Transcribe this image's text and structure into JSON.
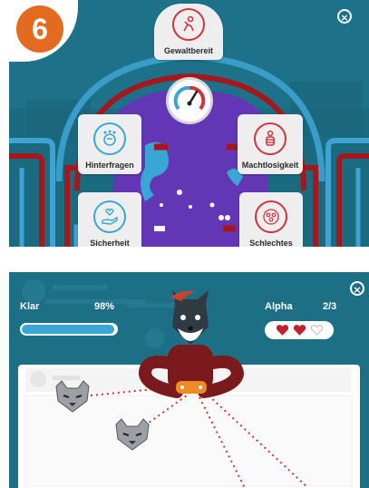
{
  "top_panel": {
    "step_number": "6",
    "close_icon": "close-icon",
    "nodes": {
      "gewaltbereit": {
        "label": "Gewaltbereit",
        "icon": "figure-icon"
      },
      "hinterfragen": {
        "label": "Hinterfragen",
        "icon": "thinking-head-icon"
      },
      "machtlosigkeit": {
        "label": "Machtlosigkeit",
        "icon": "bound-person-icon"
      },
      "sicherheit": {
        "label": "Sicherheit",
        "icon": "hand-heart-icon"
      },
      "schlechtes": {
        "label": "Schlechtes",
        "icon": "group-icon"
      }
    },
    "gauge_icon": "gauge-icon",
    "colors": {
      "accent_red": "#d0343d",
      "accent_blue": "#3aa6d6",
      "pipe_red": "#a5171d",
      "pipe_blue": "#3fa3d3",
      "purple": "#6236b4"
    }
  },
  "bottom_panel": {
    "close_icon": "close-icon",
    "klar": {
      "label": "Klar",
      "percent_text": "98%",
      "progress": 0.98
    },
    "alpha": {
      "label": "Alpha",
      "count_text": "2/3",
      "hearts_filled": 2,
      "hearts_total": 3
    },
    "colors": {
      "bar_fill": "#3aa6d6",
      "heart_red": "#c2202c"
    }
  }
}
